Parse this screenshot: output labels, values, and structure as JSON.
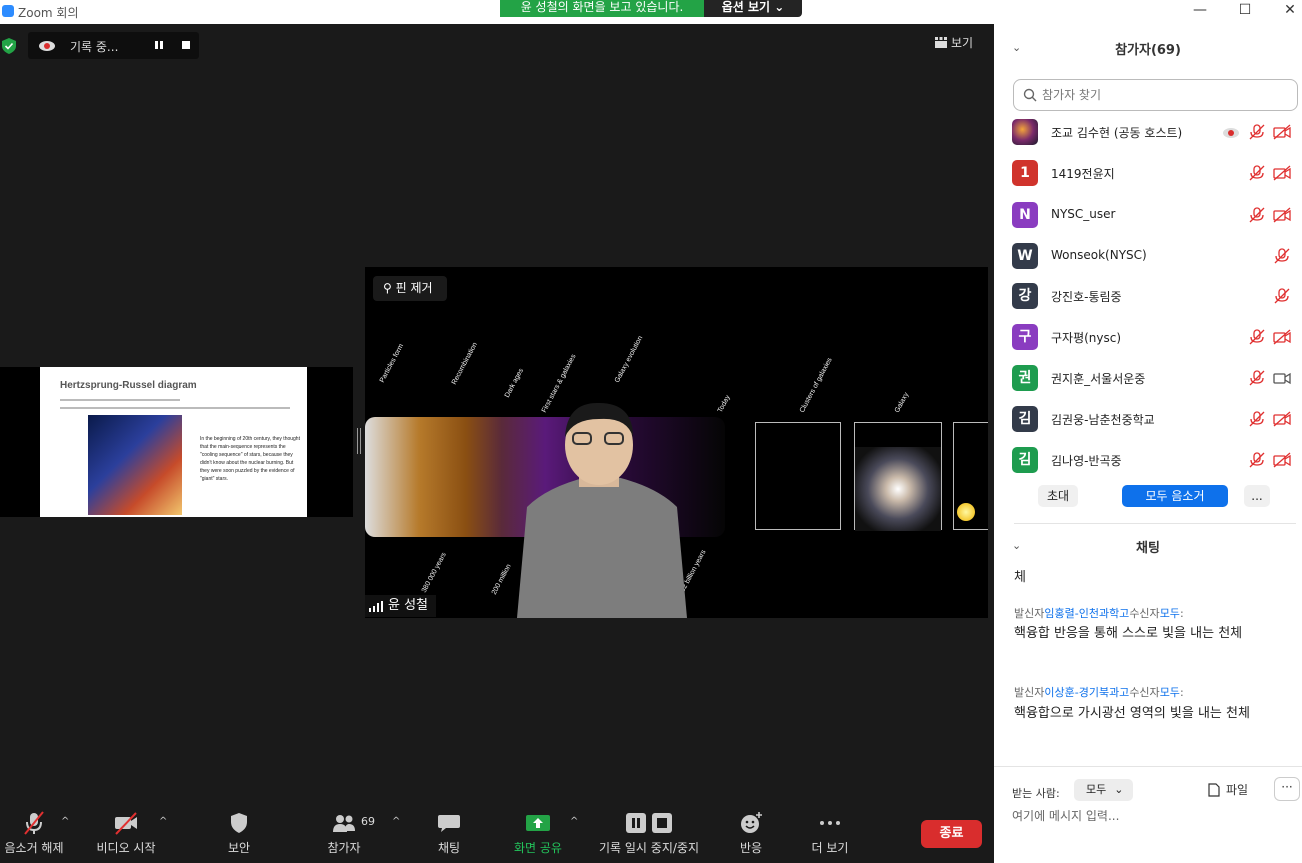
{
  "window": {
    "title": "Zoom 회의",
    "minimize": "—",
    "maximize": "☐",
    "close": "✕"
  },
  "share_banner": {
    "message": "윤 성철의 화면을 보고 있습니다.",
    "options": "옵션 보기 ⌄"
  },
  "recording": {
    "label": "기록 중..."
  },
  "view_button": {
    "label": "보기"
  },
  "slide": {
    "title": "Hertzsprung-Russel diagram",
    "body": "In the beginning of 20th century, they thought that the main-sequence represents the \"cooling sequence\" of stars, because they didn't know about the nuclear burning. But they were soon puzzled by the evidence of \"giant\" stars."
  },
  "video": {
    "unpin_label": "핀 제거",
    "speaker_name": "윤 성철",
    "labels": {
      "particles": "Particles form",
      "recombination": "Recombination",
      "dark_ages": "Dark ages",
      "first_stars": "First stars & galaxies",
      "galaxy_evolution": "Galaxy evolution",
      "today": "Today",
      "clusters": "Clusters of galaxies",
      "galaxy": "Galaxy",
      "years380k": "380 000 years",
      "years200m": "200 million",
      "years13b": "13.82 billion years"
    }
  },
  "toolbar": {
    "mute": "음소거 해제",
    "video": "비디오 시작",
    "security": "보안",
    "participants": "참가자",
    "participants_count": "69",
    "chat": "채팅",
    "share": "화면 공유",
    "record": "기록 일시 중지/중지",
    "reactions": "반응",
    "more": "더 보기",
    "end": "종료"
  },
  "panel": {
    "participants_header": "참가자(69)",
    "search_placeholder": "참가자 찾기",
    "participants": [
      {
        "initial": "",
        "name": "조교 김수현 (공동 호스트)",
        "color": "#3a2a3a"
      },
      {
        "initial": "1",
        "name": "1419전윤지",
        "color": "#d0332c"
      },
      {
        "initial": "N",
        "name": "NYSC_user",
        "color": "#8a3cc0"
      },
      {
        "initial": "W",
        "name": "Wonseok(NYSC)",
        "color": "#333b4a"
      },
      {
        "initial": "강",
        "name": "강진호-통림중",
        "color": "#333b4a"
      },
      {
        "initial": "구",
        "name": "구자평(nysc)",
        "color": "#8a3cc0"
      },
      {
        "initial": "권",
        "name": "권지훈_서울서운중",
        "color": "#1e9c4f"
      },
      {
        "initial": "김",
        "name": "김권웅-남춘천중학교",
        "color": "#333b4a"
      },
      {
        "initial": "김",
        "name": "김나영-반곡중",
        "color": "#1e9c4f"
      }
    ],
    "invite": "초대",
    "mute_all": "모두 음소거",
    "more": "...",
    "chat_header": "채팅",
    "chat_partial": "체",
    "messages": [
      {
        "prefix": "발신자",
        "sender": "임홍렬-인천과학고",
        "mid": "수신자",
        "to": "모두",
        "colon": ":",
        "text": "핵융합 반응을 통해 스스로 빛을 내는 천체"
      },
      {
        "prefix": "발신자",
        "sender": "이상훈-경기북과고",
        "mid": "수신자",
        "to": "모두",
        "colon": ":",
        "text": "핵융합으로 가시광선 영역의 빛을 내는 천체"
      }
    ],
    "recipient_label": "받는 사람:",
    "recipient_value": "모두",
    "file_label": "파일",
    "more_label": "···",
    "input_placeholder": "여기에 메시지 입력..."
  },
  "colors": {
    "share_green": "#23a346",
    "end_red": "#d92d2d",
    "link_blue": "#0e71eb"
  }
}
